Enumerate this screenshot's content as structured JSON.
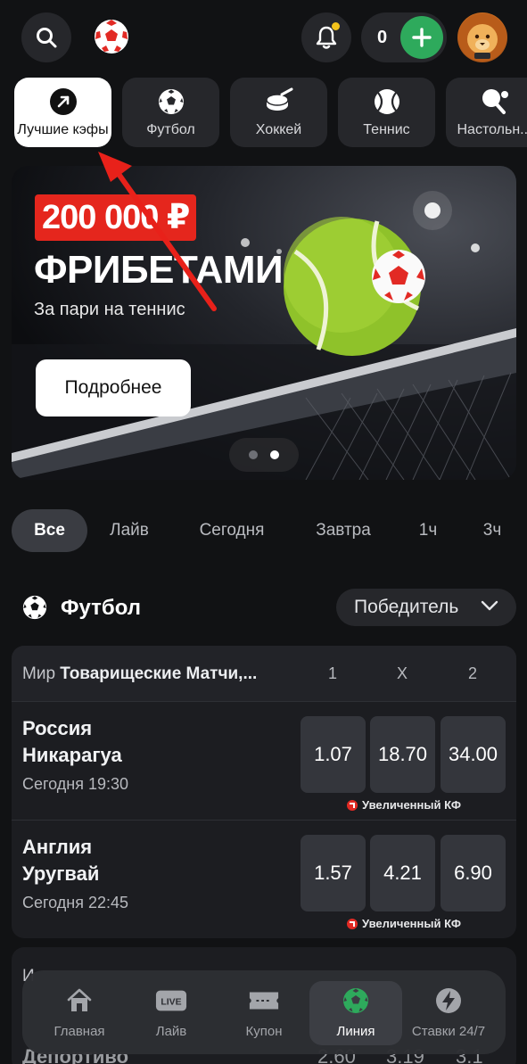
{
  "header": {
    "balance": "0",
    "notification_dot_color": "#f2c21b",
    "plus_color": "#2eaa5c",
    "icons": [
      "search-icon",
      "brand-logo",
      "bell-icon",
      "plus-icon",
      "avatar-lion"
    ]
  },
  "sports": [
    {
      "label": "Лучшие кэфы",
      "icon": "arrow-up-right-icon",
      "active": true
    },
    {
      "label": "Футбол",
      "icon": "soccer-ball-icon",
      "active": false
    },
    {
      "label": "Хоккей",
      "icon": "hockey-puck-icon",
      "active": false
    },
    {
      "label": "Теннис",
      "icon": "tennis-ball-icon",
      "active": false
    },
    {
      "label": "Настольн...",
      "icon": "ping-pong-icon",
      "active": false
    }
  ],
  "banner": {
    "badge": "200 000 ₽",
    "title": "ФРИБЕТАМИ",
    "subtitle": "За пари на теннис",
    "button": "Подробнее",
    "slides": 2,
    "active_slide": 2,
    "badge_color": "#e5261d"
  },
  "filters": [
    {
      "label": "Все",
      "active": true
    },
    {
      "label": "Лайв",
      "active": false
    },
    {
      "label": "Сегодня",
      "active": false
    },
    {
      "label": "Завтра",
      "active": false
    },
    {
      "label": "1ч",
      "active": false
    },
    {
      "label": "3ч",
      "active": false
    }
  ],
  "section": {
    "title": "Футбол",
    "market": "Победитель"
  },
  "event_card": {
    "league_prefix": "Мир",
    "league_name": "Товарищеские Матчи,...",
    "columns": [
      "1",
      "X",
      "2"
    ],
    "matches": [
      {
        "team1": "Россия",
        "team2": "Никарагуа",
        "time": "Сегодня 19:30",
        "odds": [
          "1.07",
          "18.70",
          "34.00"
        ],
        "boost": "Увеличенный КФ"
      },
      {
        "team1": "Англия",
        "team2": "Уругвай",
        "time": "Сегодня 22:45",
        "odds": [
          "1.57",
          "4.21",
          "6.90"
        ],
        "boost": "Увеличенный КФ"
      }
    ]
  },
  "next_card": {
    "league": "И",
    "team": "Депортиво",
    "odds": [
      "2.60",
      "3.19",
      "3.1"
    ]
  },
  "bottom_nav": [
    {
      "label": "Главная",
      "icon": "home-icon",
      "active": false
    },
    {
      "label": "Лайв",
      "icon": "live-icon",
      "icon_text": "LIVE",
      "active": false
    },
    {
      "label": "Купон",
      "icon": "coupon-icon",
      "active": false
    },
    {
      "label": "Линия",
      "icon": "soccer-ball-icon",
      "active": true
    },
    {
      "label": "Ставки 24/7",
      "icon": "lightning-icon",
      "active": false
    }
  ],
  "annotation_color": "#e8211a"
}
